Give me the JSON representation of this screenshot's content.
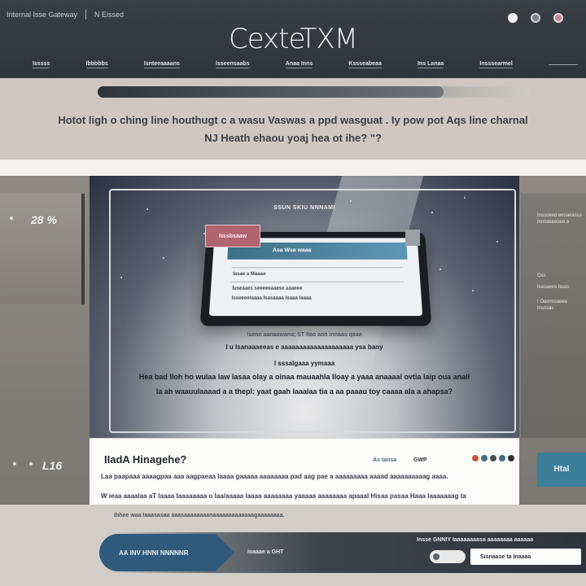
{
  "header": {
    "left_label": "Internal Isse Gateway",
    "left_sub": "N Eissed",
    "brand": "CexteTXM",
    "nav": [
      "Isssss",
      "Ibbbbbs",
      "Isnteeaaaans",
      "Isseensaabs",
      "Anaa Inns",
      "Kssseabeaa",
      "Ins Lanaa",
      "Insssearmel"
    ]
  },
  "banner": {
    "progress_percent": 80,
    "line1": "Hotot ligh o ching line houthugt c a wasu Vaswas a ppd wasguat . Iy pow pot Aqs line charnal",
    "line2": "NJ Heath ehaou yoaj hea ot ihe? \"?"
  },
  "sidebar": {
    "stat_top": "28 %",
    "stat_bottom": "L16"
  },
  "right_panel": {
    "line1": "Inssoeed eesaeasss",
    "line2": "Innsaseesee a",
    "line3": "Oss",
    "line4": "Isasaees Isuss",
    "line5": "I Oasnssaeea",
    "line6": "Insssas"
  },
  "hero": {
    "title": "SSUN SKIU NNNAMI",
    "tablet_header": "Asa Wsa waaa",
    "pink_tag": "Nssbsaaw",
    "tablet_line1": "Iasae a Maaaa",
    "tablet_line2": "Iuseaaes seeeeeaaese aaaeee",
    "tablet_line3": "Isseeeeiaaaa Isasaaaa Isaaa Iaaaa",
    "caption1": "Isenn aanaawana; ST IIao aon innaas qaaa",
    "caption2": "I u Isanaaaeeas e aaaaaaaaaaaaaaaaaaaa ysa bany",
    "caption3": "I sssalgaaa yymaaa",
    "caption4": "Hea bad Iloh ho wulaa law lasaa olay a oinaa mauaahla Iloay a yaaa anaaaal ovtia laip oua anall",
    "caption5": "Ia ah waauulaaaad a a thepl: yaat gaah Iaaalaa tia a aa paaau toy caaaa ala a ahapsa?"
  },
  "card": {
    "title": "IIadA Hinagehe?",
    "tag1": "As tansa",
    "tag2": "GWP",
    "line1": "Laa paapaaa aaaagpaa aaa aagpaeaa laaaa gaaaaa aaaaaaaa pad aag pae a aaaaaaaaa aaaad aaaaaaaaaag aaaa.",
    "line2": "W ieaa aaaalaa aT laaaa Iaaaaaaaa o Iaa/aaaaa laaaa aaaaaaaa yaaaaa aaaaaaaa apaaaI Hisaa pasaa Haaa Iaaaaaaag ta",
    "side_button": "Htal"
  },
  "footer": {
    "note": "Ihhee waa Iaaasasaa aaasaaaaaaaanaaaaaaaaaaaaagaaaaaaaa.",
    "cta": "AA INV HNNI NNNNNR",
    "mid_text": "Ioaaae a GHT",
    "right_text": "Insse GNNIY Iaaaaaaaasa aaaaaaaa aaaaaa",
    "search_value": "Sisnaase ta Inaaaa"
  },
  "colors": {
    "accent": "#3d7f9a",
    "header_bg": "#353a41",
    "cta_bg": "#2f5a7c",
    "pink": "#b2646f"
  }
}
